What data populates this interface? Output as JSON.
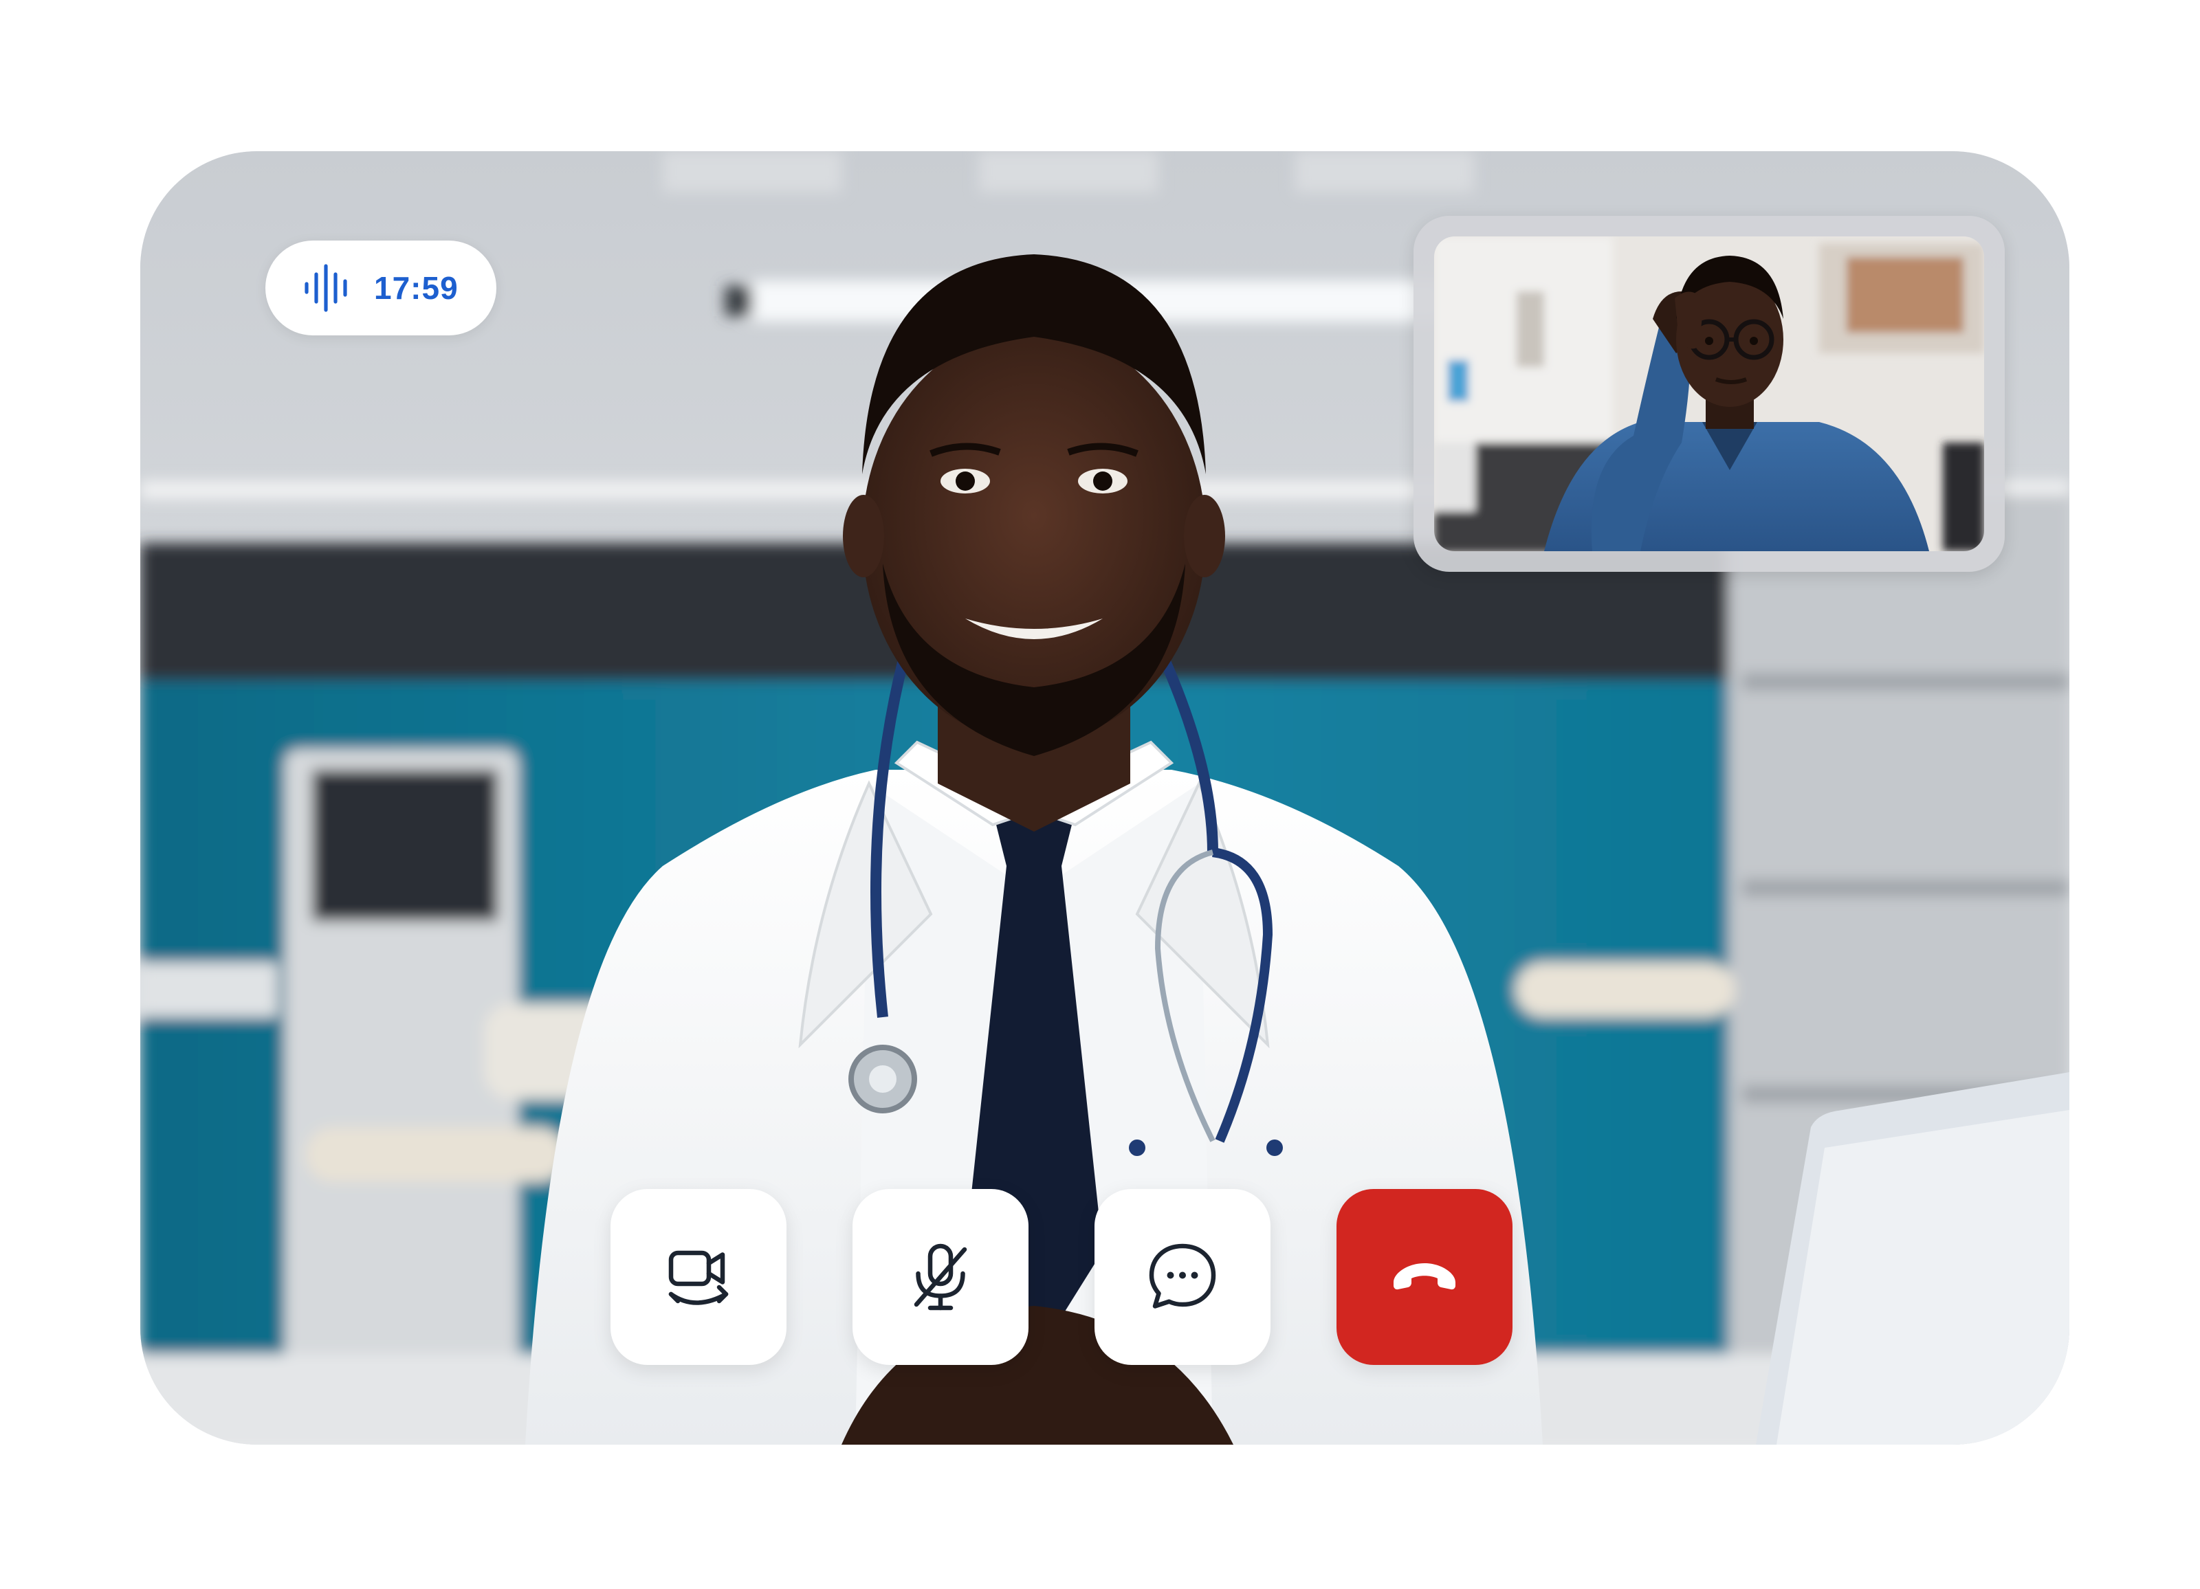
{
  "call": {
    "timer": "17:59",
    "status_icon": "audio-wave-icon",
    "accent_color": "#1d5fcf"
  },
  "main_video": {
    "icon": "video-feed"
  },
  "self_view": {
    "icon": "video-feed"
  },
  "controls": [
    {
      "name": "switch-camera-button",
      "icon": "video-switch-icon"
    },
    {
      "name": "mute-button",
      "icon": "mic-off-icon"
    },
    {
      "name": "chat-button",
      "icon": "chat-bubble-icon"
    },
    {
      "name": "end-call-button",
      "icon": "phone-hangup-icon",
      "color": "#d22620"
    }
  ]
}
